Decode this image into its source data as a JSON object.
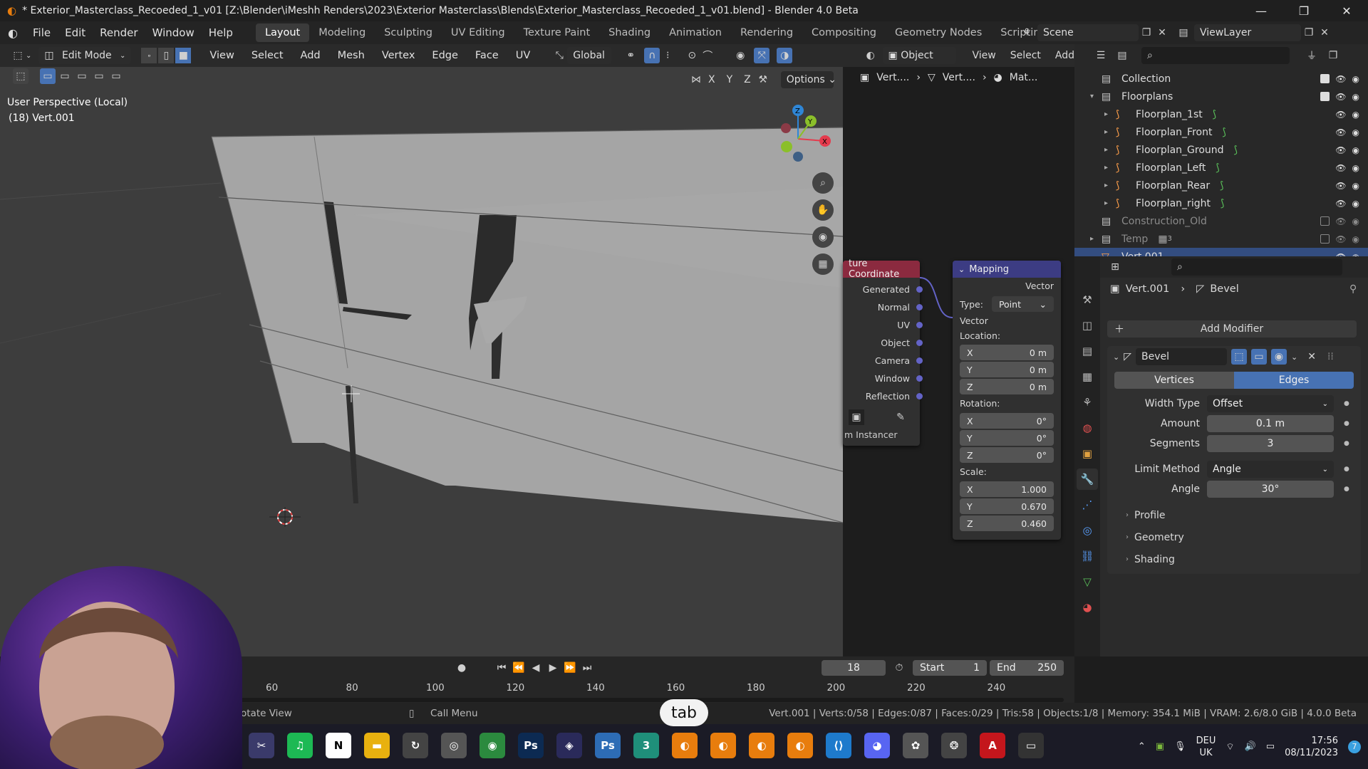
{
  "titlebar": {
    "title": "* Exterior_Masterclass_Recoeded_1_v01 [Z:\\Blender\\iMeshh Renders\\2023\\Exterior Masterclass\\Blends\\Exterior_Masterclass_Recoeded_1_v01.blend] - Blender 4.0 Beta",
    "minimize": "—",
    "restore": "❐",
    "close": "✕"
  },
  "menu": {
    "items": [
      "File",
      "Edit",
      "Render",
      "Window",
      "Help"
    ],
    "workspaces": [
      "Layout",
      "Modeling",
      "Sculpting",
      "UV Editing",
      "Texture Paint",
      "Shading",
      "Animation",
      "Rendering",
      "Compositing",
      "Geometry Nodes",
      "Scripting"
    ],
    "add_tab": "+",
    "scene": "Scene",
    "view_layer": "ViewLayer"
  },
  "vp_header": {
    "mode": "Edit Mode",
    "menus": [
      "View",
      "Select",
      "Add",
      "Mesh",
      "Vertex",
      "Edge",
      "Face",
      "UV"
    ],
    "orientation": "Global",
    "options": "Options",
    "axes": [
      "X",
      "Y",
      "Z"
    ]
  },
  "viewport": {
    "perspective": "User Perspective (Local)",
    "object_info": "(18) Vert.001"
  },
  "node_header": {
    "object_mode": "Object",
    "menus": [
      "View",
      "Select",
      "Add"
    ],
    "breadcrumb": [
      "Vert....",
      "Vert....",
      "Mat..."
    ]
  },
  "nodes": {
    "texcoord": {
      "title": "ture Coordinate",
      "outputs": [
        "Generated",
        "Normal",
        "UV",
        "Object",
        "Camera",
        "Window",
        "Reflection"
      ],
      "instancer": "m Instancer"
    },
    "mapping": {
      "title": "Mapping",
      "output": "Vector",
      "type_label": "Type:",
      "type_value": "Point",
      "vector": "Vector",
      "location": "Location:",
      "rotation": "Rotation:",
      "scale": "Scale:",
      "loc": [
        [
          "X",
          "0 m"
        ],
        [
          "Y",
          "0 m"
        ],
        [
          "Z",
          "0 m"
        ]
      ],
      "rot": [
        [
          "X",
          "0°"
        ],
        [
          "Y",
          "0°"
        ],
        [
          "Z",
          "0°"
        ]
      ],
      "scl": [
        [
          "X",
          "1.000"
        ],
        [
          "Y",
          "0.670"
        ],
        [
          "Z",
          "0.460"
        ]
      ]
    }
  },
  "outliner": {
    "rows": [
      {
        "name": "Collection",
        "indent": 0,
        "kind": "collection"
      },
      {
        "name": "Floorplans",
        "indent": 0,
        "kind": "collection",
        "expanded": true
      },
      {
        "name": "Floorplan_1st",
        "indent": 1,
        "kind": "curve"
      },
      {
        "name": "Floorplan_Front",
        "indent": 1,
        "kind": "curve"
      },
      {
        "name": "Floorplan_Ground",
        "indent": 1,
        "kind": "curve"
      },
      {
        "name": "Floorplan_Left",
        "indent": 1,
        "kind": "curve"
      },
      {
        "name": "Floorplan_Rear",
        "indent": 1,
        "kind": "curve"
      },
      {
        "name": "Floorplan_right",
        "indent": 1,
        "kind": "curve"
      },
      {
        "name": "Construction_Old",
        "indent": 0,
        "kind": "collection",
        "dim": true
      },
      {
        "name": "Temp",
        "indent": 0,
        "kind": "collection",
        "dim": true,
        "count": "3"
      },
      {
        "name": "Vert.001",
        "indent": 0,
        "kind": "mesh",
        "selected": true
      }
    ]
  },
  "props": {
    "breadcrumb_obj": "Vert.001",
    "breadcrumb_mod": "Bevel",
    "add_modifier": "Add Modifier",
    "modifier_name": "Bevel",
    "seg_vertices": "Vertices",
    "seg_edges": "Edges",
    "rows": [
      {
        "label": "Width Type",
        "value": "Offset",
        "dropdown": true
      },
      {
        "label": "Amount",
        "value": "0.1 m"
      },
      {
        "label": "Segments",
        "value": "3"
      },
      {
        "label": "Limit Method",
        "value": "Angle",
        "dropdown": true
      },
      {
        "label": "Angle",
        "value": "30°"
      }
    ],
    "panels": [
      "Profile",
      "Geometry",
      "Shading"
    ]
  },
  "timeline": {
    "current_frame": "18",
    "start_label": "Start",
    "start": "1",
    "end_label": "End",
    "end": "250",
    "ticks": [
      "60",
      "80",
      "100",
      "120",
      "140",
      "160",
      "180",
      "200",
      "220",
      "240"
    ]
  },
  "status": {
    "left": "otate View",
    "call_menu": "Call Menu",
    "stats": "Vert.001 | Verts:0/58 | Edges:0/87 | Faces:0/29 | Tris:58 | Objects:1/8 | Memory: 354.1 MiB | VRAM: 2.6/8.0 GiB | 4.0.0 Beta"
  },
  "key_overlay": "tab",
  "taskbar": {
    "lang": "DEU",
    "layout": "UK",
    "time": "17:56",
    "date": "08/11/2023",
    "badge": "7",
    "apps": [
      {
        "name": "snipping-tool",
        "label": "✂",
        "color": "#3a3a6a"
      },
      {
        "name": "spotify",
        "label": "♫",
        "color": "#1db954"
      },
      {
        "name": "notion",
        "label": "N",
        "color": "#ffffff"
      },
      {
        "name": "file-explorer",
        "label": "▬",
        "color": "#e8b10f"
      },
      {
        "name": "sync-app",
        "label": "↻",
        "color": "#444"
      },
      {
        "name": "chrome-dev",
        "label": "◎",
        "color": "#555"
      },
      {
        "name": "chrome",
        "label": "◉",
        "color": "#2b8a3e"
      },
      {
        "name": "photoshop",
        "label": "Ps",
        "color": "#0c2a52"
      },
      {
        "name": "media-encoder",
        "label": "◈",
        "color": "#2a2a5a"
      },
      {
        "name": "photoshop-2",
        "label": "Ps",
        "color": "#2d6cb5"
      },
      {
        "name": "app-3",
        "label": "3",
        "color": "#1f8f7a"
      },
      {
        "name": "blender-1",
        "label": "◐",
        "color": "#e87d0d"
      },
      {
        "name": "blender-2",
        "label": "◐",
        "color": "#e87d0d"
      },
      {
        "name": "blender-3",
        "label": "◐",
        "color": "#e87d0d"
      },
      {
        "name": "blender-4",
        "label": "◐",
        "color": "#e87d0d"
      },
      {
        "name": "vscode",
        "label": "⟨⟩",
        "color": "#1e7acc"
      },
      {
        "name": "discord",
        "label": "◕",
        "color": "#5865f2"
      },
      {
        "name": "chatgpt",
        "label": "✿",
        "color": "#555"
      },
      {
        "name": "davinci",
        "label": "❂",
        "color": "#444"
      },
      {
        "name": "acrobat",
        "label": "A",
        "color": "#c4161c"
      },
      {
        "name": "terminal",
        "label": "▭",
        "color": "#333"
      }
    ]
  },
  "colors": {
    "accent": "#4772b3",
    "node_texcoord": "#8b2a3f",
    "node_mapping": "#3c3c83",
    "socket": "#6363c7",
    "gizmo_x": "#e53b4d",
    "gizmo_y": "#8bbf2a",
    "gizmo_z": "#2f86d6"
  }
}
